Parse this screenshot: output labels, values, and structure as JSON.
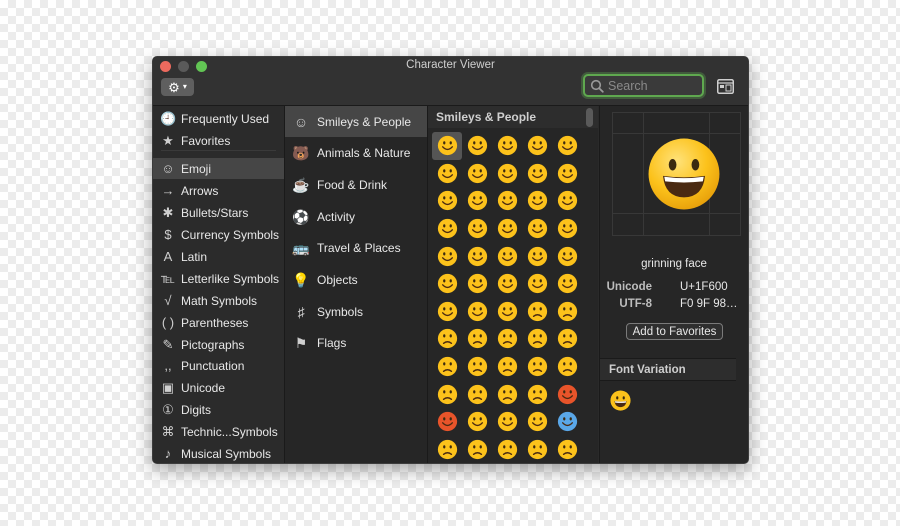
{
  "window": {
    "title": "Character Viewer"
  },
  "toolbar": {
    "gear_icon": "gear-icon",
    "search_placeholder": "Search",
    "search_value": ""
  },
  "sidebar": {
    "items": [
      {
        "label": "Frequently Used",
        "icon": "🕘"
      },
      {
        "label": "Favorites",
        "icon": "★"
      },
      {
        "label": "Emoji",
        "icon": "☺",
        "selected": true
      },
      {
        "label": "Arrows",
        "icon": "→"
      },
      {
        "label": "Bullets/Stars",
        "icon": "✱"
      },
      {
        "label": "Currency Symbols",
        "icon": "$"
      },
      {
        "label": "Latin",
        "icon": "A"
      },
      {
        "label": "Letterlike Symbols",
        "icon": "℡"
      },
      {
        "label": "Math Symbols",
        "icon": "√"
      },
      {
        "label": "Parentheses",
        "icon": "( )"
      },
      {
        "label": "Pictographs",
        "icon": "✎"
      },
      {
        "label": "Punctuation",
        "icon": ",,"
      },
      {
        "label": "Unicode",
        "icon": "▣"
      },
      {
        "label": "Digits",
        "icon": "①"
      },
      {
        "label": "Technic...Symbols",
        "icon": "⌘"
      },
      {
        "label": "Musical Symbols",
        "icon": "♪"
      }
    ]
  },
  "categories": {
    "items": [
      {
        "label": "Smileys & People",
        "icon": "☺",
        "selected": true
      },
      {
        "label": "Animals & Nature",
        "icon": "🐻"
      },
      {
        "label": "Food & Drink",
        "icon": "☕"
      },
      {
        "label": "Activity",
        "icon": "⚽"
      },
      {
        "label": "Travel & Places",
        "icon": "🚌"
      },
      {
        "label": "Objects",
        "icon": "💡"
      },
      {
        "label": "Symbols",
        "icon": "♯"
      },
      {
        "label": "Flags",
        "icon": "⚑"
      }
    ]
  },
  "grid": {
    "header": "Smileys & People",
    "emojis": [
      "😀",
      "😃",
      "😄",
      "😁",
      "😆",
      "😅",
      "😂",
      "🤣",
      "☺️",
      "😊",
      "😇",
      "🙂",
      "🙃",
      "😉",
      "😌",
      "😍",
      "🥰",
      "😘",
      "😗",
      "😙",
      "😚",
      "😋",
      "😛",
      "😝",
      "😜",
      "🤪",
      "🤨",
      "🧐",
      "🤓",
      "😎",
      "🤩",
      "🥳",
      "😏",
      "😒",
      "😞",
      "😔",
      "😟",
      "😕",
      "🙁",
      "☹️",
      "😣",
      "😖",
      "😫",
      "😩",
      "🥺",
      "😢",
      "😭",
      "😤",
      "😠",
      "😡",
      "🤬",
      "🤯",
      "😳",
      "🥵",
      "🥶",
      "😱",
      "😨",
      "😰",
      "😥",
      "😓"
    ]
  },
  "detail": {
    "selected_emoji": "😀",
    "name": "grinning face",
    "unicode_label": "Unicode",
    "unicode_value": "U+1F600",
    "utf8_label": "UTF-8",
    "utf8_value": "F0 9F 98…",
    "add_favorites_label": "Add to Favorites",
    "font_variation_label": "Font Variation"
  }
}
